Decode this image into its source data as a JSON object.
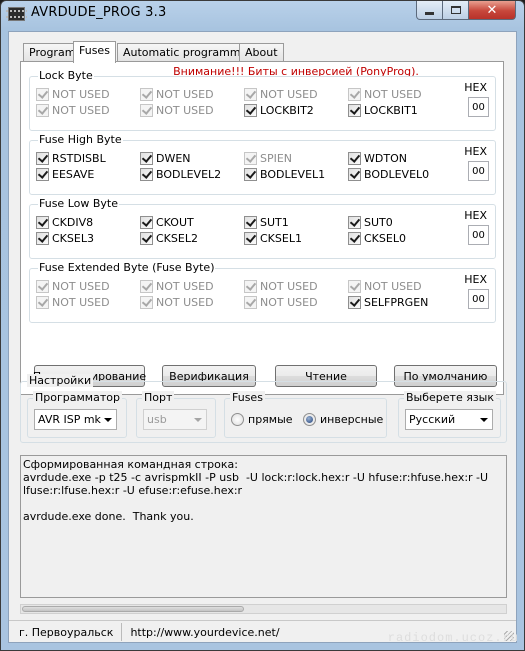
{
  "window": {
    "title": "AVRDUDE_PROG 3.3"
  },
  "tabs": [
    "Program",
    "Fuses",
    "Automatic programming",
    "About"
  ],
  "warning": "Внимание!!! Биты с инверсией (PonyProg).",
  "hex_label": "HEX",
  "groups": [
    {
      "title": "Lock Byte",
      "hex": "00",
      "bits": [
        {
          "label": "NOT USED",
          "checked": true,
          "enabled": false
        },
        {
          "label": "NOT USED",
          "checked": true,
          "enabled": false
        },
        {
          "label": "NOT USED",
          "checked": true,
          "enabled": false
        },
        {
          "label": "NOT USED",
          "checked": true,
          "enabled": false
        },
        {
          "label": "NOT USED",
          "checked": true,
          "enabled": false
        },
        {
          "label": "NOT USED",
          "checked": true,
          "enabled": false
        },
        {
          "label": "LOCKBIT2",
          "checked": true,
          "enabled": true
        },
        {
          "label": "LOCKBIT1",
          "checked": true,
          "enabled": true
        }
      ]
    },
    {
      "title": "Fuse High Byte",
      "hex": "00",
      "bits": [
        {
          "label": "RSTDISBL",
          "checked": true,
          "enabled": true
        },
        {
          "label": "DWEN",
          "checked": true,
          "enabled": true
        },
        {
          "label": "SPIEN",
          "checked": true,
          "enabled": false
        },
        {
          "label": "WDTON",
          "checked": true,
          "enabled": true
        },
        {
          "label": "EESAVE",
          "checked": true,
          "enabled": true
        },
        {
          "label": "BODLEVEL2",
          "checked": true,
          "enabled": true
        },
        {
          "label": "BODLEVEL1",
          "checked": true,
          "enabled": true
        },
        {
          "label": "BODLEVEL0",
          "checked": true,
          "enabled": true
        }
      ]
    },
    {
      "title": "Fuse Low Byte",
      "hex": "00",
      "bits": [
        {
          "label": "CKDIV8",
          "checked": true,
          "enabled": true
        },
        {
          "label": "CKOUT",
          "checked": true,
          "enabled": true
        },
        {
          "label": "SUT1",
          "checked": true,
          "enabled": true
        },
        {
          "label": "SUT0",
          "checked": true,
          "enabled": true
        },
        {
          "label": "CKSEL3",
          "checked": true,
          "enabled": true
        },
        {
          "label": "CKSEL2",
          "checked": true,
          "enabled": true
        },
        {
          "label": "CKSEL1",
          "checked": true,
          "enabled": true
        },
        {
          "label": "CKSEL0",
          "checked": true,
          "enabled": true
        }
      ]
    },
    {
      "title": "Fuse Extended Byte (Fuse Byte)",
      "hex": "00",
      "bits": [
        {
          "label": "NOT USED",
          "checked": true,
          "enabled": false
        },
        {
          "label": "NOT USED",
          "checked": true,
          "enabled": false
        },
        {
          "label": "NOT USED",
          "checked": true,
          "enabled": false
        },
        {
          "label": "NOT USED",
          "checked": true,
          "enabled": false
        },
        {
          "label": "NOT USED",
          "checked": true,
          "enabled": false
        },
        {
          "label": "NOT USED",
          "checked": true,
          "enabled": false
        },
        {
          "label": "NOT USED",
          "checked": true,
          "enabled": false
        },
        {
          "label": "SELFPRGEN",
          "checked": true,
          "enabled": true
        }
      ]
    }
  ],
  "buttons": {
    "program": "Программирование",
    "verify": "Верификация",
    "read": "Чтение",
    "default": "По умолчанию"
  },
  "settings": {
    "title": "Настройки",
    "programmer": {
      "label": "Программатор",
      "value": "AVR ISP mk"
    },
    "port": {
      "label": "Порт",
      "value": "usb"
    },
    "fuses": {
      "label": "Fuses",
      "direct": "прямые",
      "inverse": "инверсные",
      "selected": "inverse"
    },
    "language": {
      "label": "Выберете язык",
      "value": "Русский"
    }
  },
  "log": "Сформированная командная строка:\navrdude.exe -p t25 -c avrispmkII -P usb  -U lock:r:lock.hex:r -U hfuse:r:hfuse.hex:r -U lfuse:r:lfuse.hex:r -U efuse:r:efuse.hex:r\n\navrdude.exe done.  Thank you.",
  "status": {
    "city": "г. Первоуральск",
    "url": "http://www.yourdevice.net/"
  },
  "watermark": "radiodom.ucoz.ru"
}
